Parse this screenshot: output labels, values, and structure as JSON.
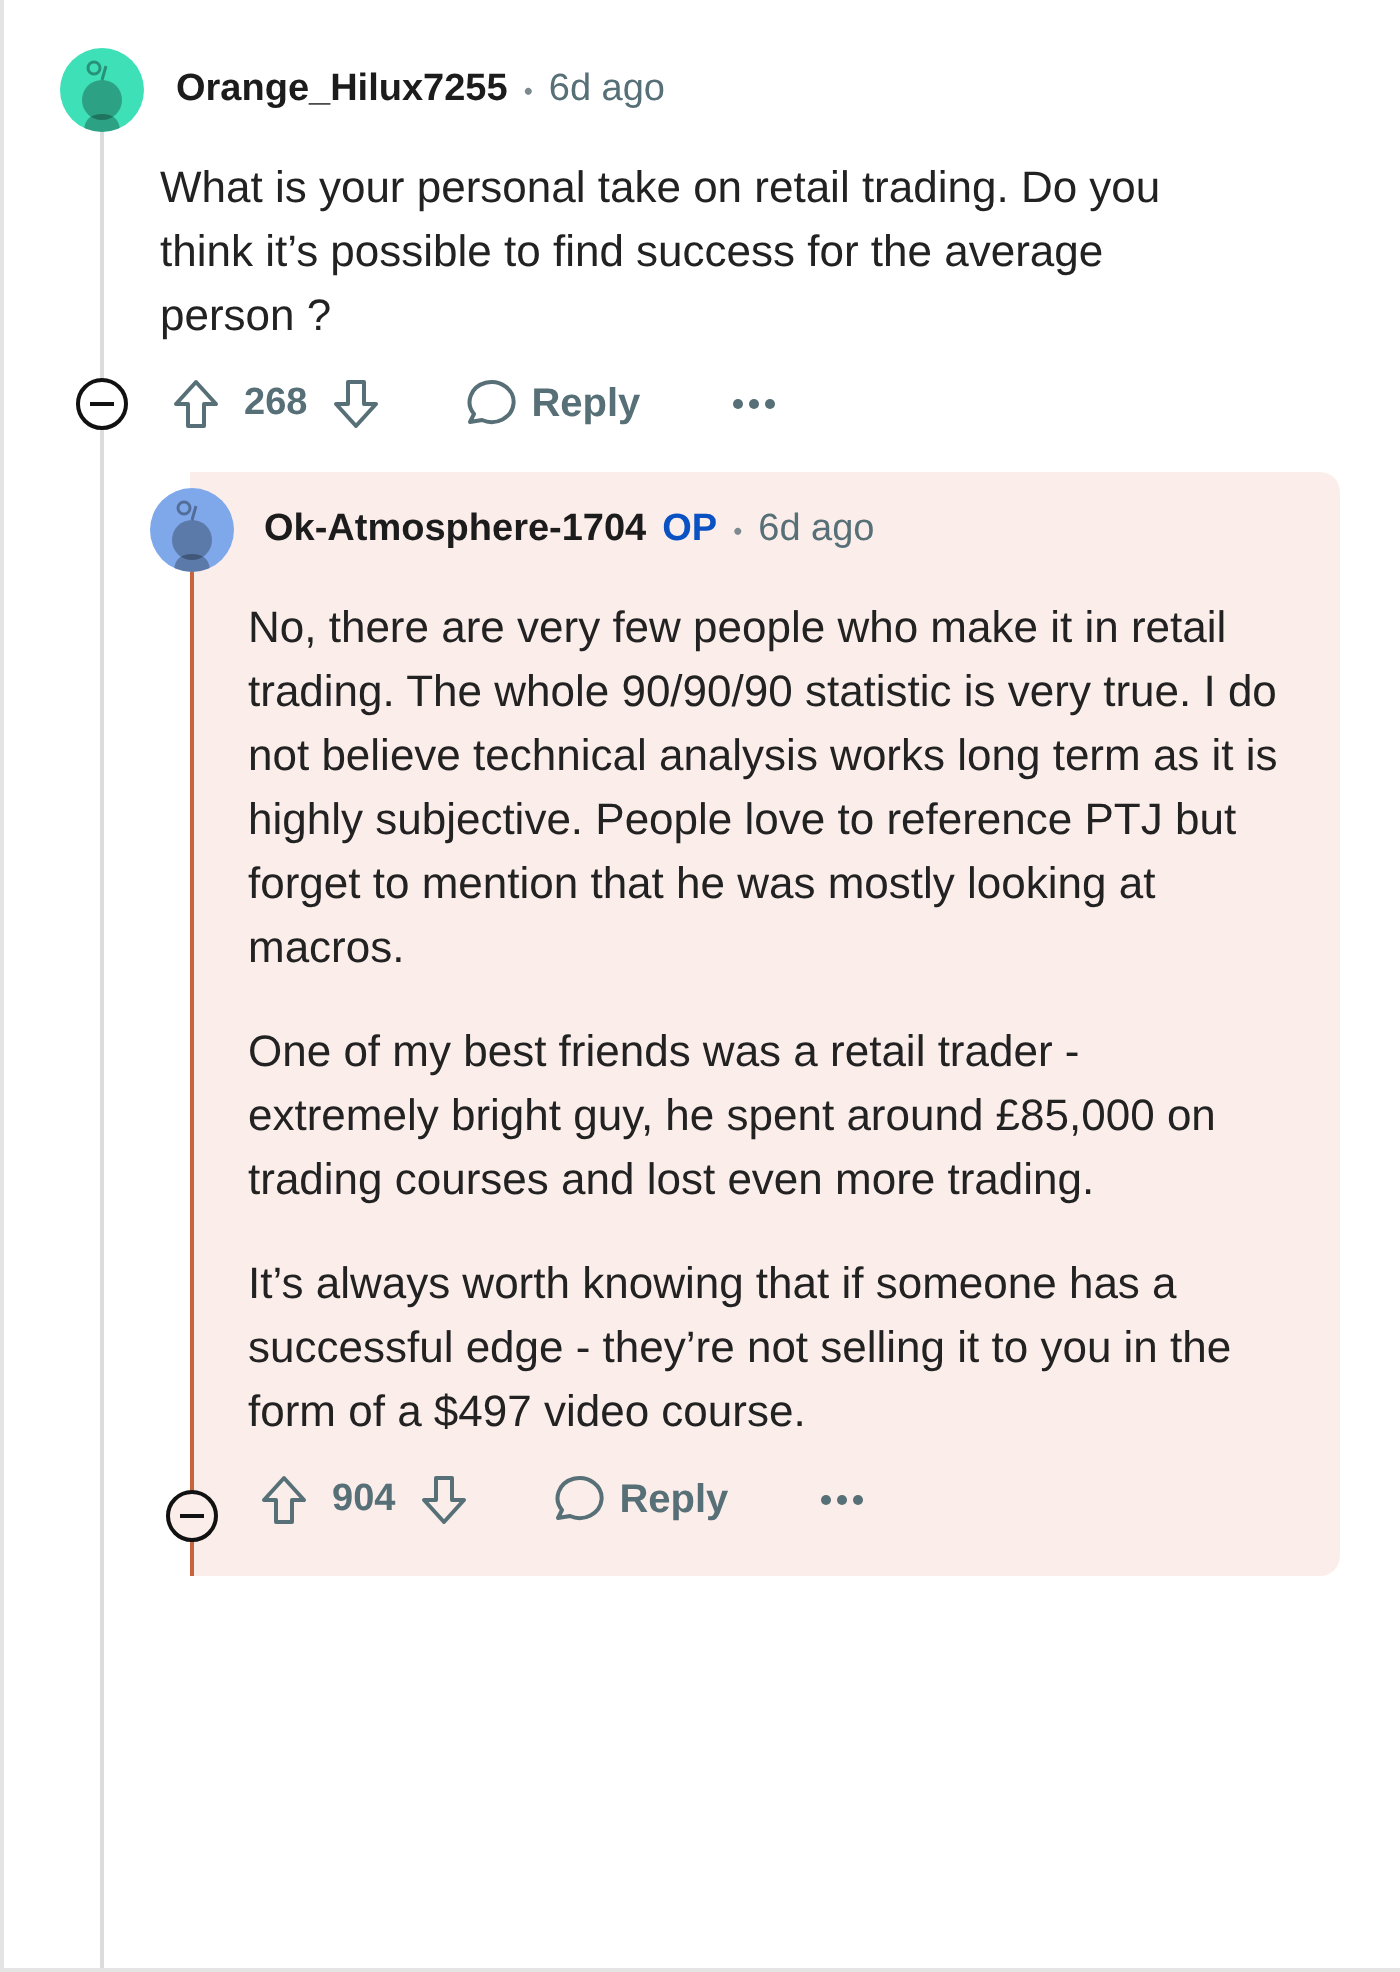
{
  "comments": [
    {
      "author": "Orange_Hilux7255",
      "color": "#3ee0b8",
      "separator": "•",
      "time": "6d ago",
      "highlighted": false,
      "paragraphs": [
        "What is your personal take on retail trading. Do you think it’s possible to find success for the average person ?"
      ],
      "score": "268",
      "reply_label": "Reply",
      "replies": [
        {
          "author": "Ok-Atmosphere-1704",
          "badge": "OP",
          "color": "#7fa8ea",
          "separator": "•",
          "time": "6d ago",
          "highlighted": true,
          "paragraphs": [
            "No, there are very few people who make it in retail trading. The whole 90/90/90 statistic is very true. I do not believe technical analysis works long term as it is highly subjective. People love to reference PTJ but forget to mention that he was mostly looking at macros.",
            "One of my best friends was a retail trader - extremely bright guy, he spent around £85,000 on trading courses and lost even more trading.",
            "It’s always worth knowing that if someone has a successful edge - they’re not selling it to you in the form of a $497 video course."
          ],
          "score": "904",
          "reply_label": "Reply"
        }
      ]
    }
  ]
}
